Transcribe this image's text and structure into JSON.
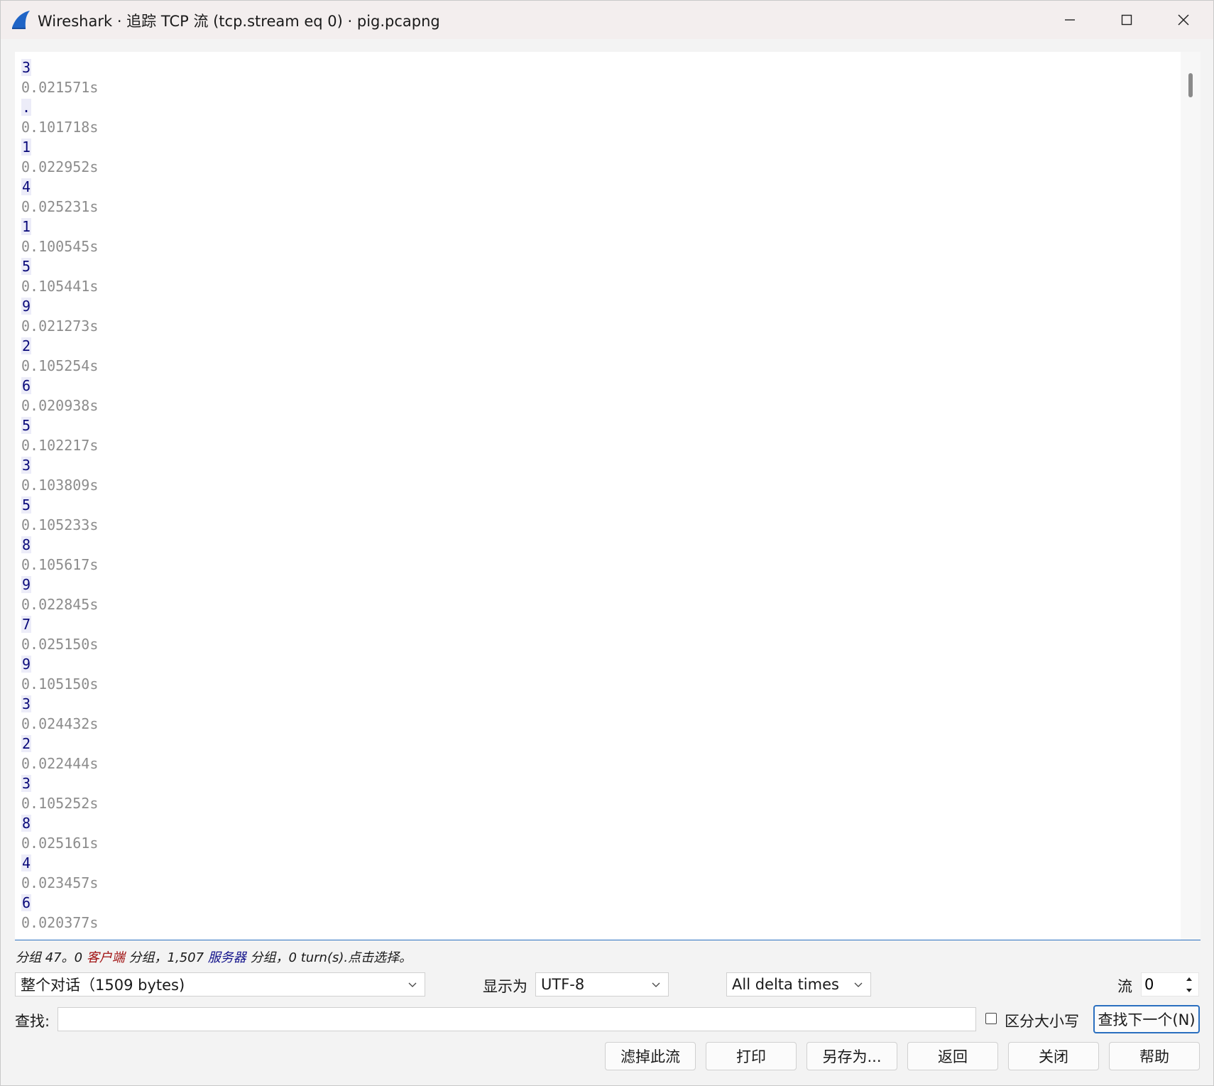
{
  "window": {
    "title": "Wireshark · 追踪 TCP 流 (tcp.stream eq 0) · pig.pcapng"
  },
  "stream": {
    "lines": [
      {
        "kind": "data",
        "text": "3"
      },
      {
        "kind": "delta",
        "text": "0.021571s"
      },
      {
        "kind": "data",
        "text": "."
      },
      {
        "kind": "delta",
        "text": "0.101718s"
      },
      {
        "kind": "data",
        "text": "1"
      },
      {
        "kind": "delta",
        "text": "0.022952s"
      },
      {
        "kind": "data",
        "text": "4"
      },
      {
        "kind": "delta",
        "text": "0.025231s"
      },
      {
        "kind": "data",
        "text": "1"
      },
      {
        "kind": "delta",
        "text": "0.100545s"
      },
      {
        "kind": "data",
        "text": "5"
      },
      {
        "kind": "delta",
        "text": "0.105441s"
      },
      {
        "kind": "data",
        "text": "9"
      },
      {
        "kind": "delta",
        "text": "0.021273s"
      },
      {
        "kind": "data",
        "text": "2"
      },
      {
        "kind": "delta",
        "text": "0.105254s"
      },
      {
        "kind": "data",
        "text": "6"
      },
      {
        "kind": "delta",
        "text": "0.020938s"
      },
      {
        "kind": "data",
        "text": "5"
      },
      {
        "kind": "delta",
        "text": "0.102217s"
      },
      {
        "kind": "data",
        "text": "3"
      },
      {
        "kind": "delta",
        "text": "0.103809s"
      },
      {
        "kind": "data",
        "text": "5"
      },
      {
        "kind": "delta",
        "text": "0.105233s"
      },
      {
        "kind": "data",
        "text": "8"
      },
      {
        "kind": "delta",
        "text": "0.105617s"
      },
      {
        "kind": "data",
        "text": "9"
      },
      {
        "kind": "delta",
        "text": "0.022845s"
      },
      {
        "kind": "data",
        "text": "7"
      },
      {
        "kind": "delta",
        "text": "0.025150s"
      },
      {
        "kind": "data",
        "text": "9"
      },
      {
        "kind": "delta",
        "text": "0.105150s"
      },
      {
        "kind": "data",
        "text": "3"
      },
      {
        "kind": "delta",
        "text": "0.024432s"
      },
      {
        "kind": "data",
        "text": "2"
      },
      {
        "kind": "delta",
        "text": "0.022444s"
      },
      {
        "kind": "data",
        "text": "3"
      },
      {
        "kind": "delta",
        "text": "0.105252s"
      },
      {
        "kind": "data",
        "text": "8"
      },
      {
        "kind": "delta",
        "text": "0.025161s"
      },
      {
        "kind": "data",
        "text": "4"
      },
      {
        "kind": "delta",
        "text": "0.023457s"
      },
      {
        "kind": "data",
        "text": "6"
      },
      {
        "kind": "delta",
        "text": "0.020377s"
      }
    ]
  },
  "status": {
    "prefix": "分组 47。0 ",
    "client": "客户端",
    "middle": " 分组，1,507 ",
    "server": "服务器",
    "suffix": " 分组，0 turn(s).点击选择。"
  },
  "controls": {
    "conversation": "整个对话（1509 bytes)",
    "show_as_label": "显示为",
    "encoding": "UTF-8",
    "delta_mode": "All delta times",
    "stream_label": "流",
    "stream_value": "0"
  },
  "find": {
    "label": "查找:",
    "value": "",
    "case_label": "区分大小写",
    "find_next": "查找下一个(N)"
  },
  "buttons": {
    "filter_out": "滤掉此流",
    "print": "打印",
    "save_as": "另存为...",
    "back": "返回",
    "close": "关闭",
    "help": "帮助"
  },
  "colors": {
    "client_text": "#a01010",
    "server_text": "#10108a",
    "accent": "#2a6fbf"
  }
}
